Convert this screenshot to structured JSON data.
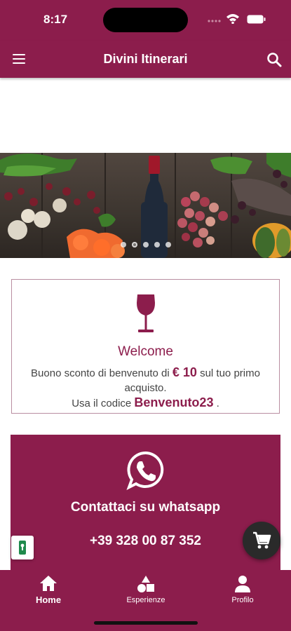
{
  "status_bar": {
    "time": "8:17"
  },
  "app_bar": {
    "title": "Divini Itinerari"
  },
  "carousel": {
    "slide_count": 5,
    "active_index": 1
  },
  "welcome": {
    "title": "Welcome",
    "line1_prefix": "Buono sconto di benvenuto di",
    "amount": "€ 10",
    "line1_suffix": "sul tuo primo",
    "line2": "acquisto.",
    "line3_prefix": "Usa il codice",
    "code": "Benvenuto23",
    "line3_suffix": "."
  },
  "contact": {
    "title": "Contattaci su whatsapp",
    "phone": "+39 328 00 87 352"
  },
  "bottom_nav": {
    "items": [
      {
        "label": "Home",
        "icon": "home-icon",
        "active": true
      },
      {
        "label": "Esperienze",
        "icon": "shapes-icon",
        "active": false
      },
      {
        "label": "Profilo",
        "icon": "person-icon",
        "active": false
      }
    ]
  },
  "colors": {
    "brand": "#8c1d4c",
    "fab": "#2a2a2a"
  }
}
